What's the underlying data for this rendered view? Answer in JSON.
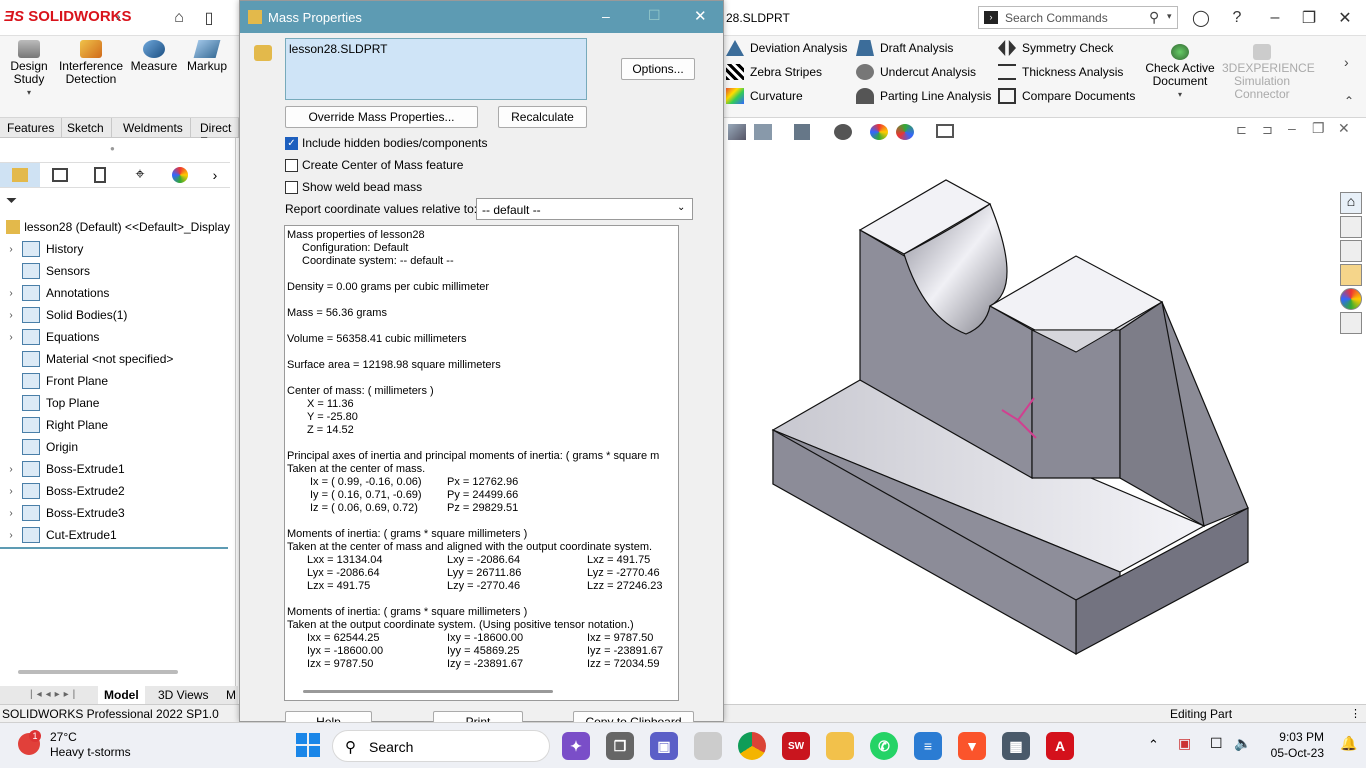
{
  "app": {
    "brand": "SOLIDWORKS",
    "doc_title": "28.SLDPRT"
  },
  "search": {
    "placeholder": "Search Commands"
  },
  "ribbon": {
    "big": [
      {
        "label": "Design Study"
      },
      {
        "label": "Interference Detection"
      },
      {
        "label": "Measure"
      },
      {
        "label": "Markup"
      }
    ],
    "col1": [
      "Deviation Analysis",
      "Zebra Stripes",
      "Curvature"
    ],
    "col2": [
      "Draft Analysis",
      "Undercut Analysis",
      "Parting Line Analysis"
    ],
    "col3": [
      "Symmetry Check",
      "Thickness Analysis",
      "Compare Documents"
    ],
    "check_active": "Check Active Document",
    "sim_connector": "3DEXPERIENCE Simulation Connector"
  },
  "tabs": [
    "Features",
    "Sketch",
    "Weldments",
    "Direct E"
  ],
  "tree": {
    "root": "lesson28 (Default) <<Default>_Display",
    "items": [
      {
        "label": "History",
        "exp": true
      },
      {
        "label": "Sensors",
        "exp": false
      },
      {
        "label": "Annotations",
        "exp": true
      },
      {
        "label": "Solid Bodies(1)",
        "exp": true
      },
      {
        "label": "Equations",
        "exp": true
      },
      {
        "label": "Material <not specified>",
        "exp": false
      },
      {
        "label": "Front Plane",
        "exp": false
      },
      {
        "label": "Top Plane",
        "exp": false
      },
      {
        "label": "Right Plane",
        "exp": false
      },
      {
        "label": "Origin",
        "exp": false
      },
      {
        "label": "Boss-Extrude1",
        "exp": true
      },
      {
        "label": "Boss-Extrude2",
        "exp": true
      },
      {
        "label": "Boss-Extrude3",
        "exp": true
      },
      {
        "label": "Cut-Extrude1",
        "exp": true
      }
    ]
  },
  "bottom_tabs": [
    "Model",
    "3D Views",
    "M"
  ],
  "dialog": {
    "title": "Mass Properties",
    "selection": "lesson28.SLDPRT",
    "options_btn": "Options...",
    "override_btn": "Override Mass Properties...",
    "recalc_btn": "Recalculate",
    "chk_hidden": "Include hidden bodies/components",
    "chk_com": "Create Center of Mass feature",
    "chk_weld": "Show weld bead mass",
    "coord_label": "Report coordinate values relative to:",
    "coord_value": "-- default --",
    "help_btn": "Help",
    "print_btn": "Print",
    "copy_btn": "Copy to Clipboard",
    "results": {
      "header": "Mass properties of lesson28",
      "config": "Configuration: Default",
      "coordsys": "Coordinate system: -- default --",
      "density": "Density = 0.00 grams per cubic millimeter",
      "mass": "Mass = 56.36 grams",
      "volume": "Volume = 56358.41 cubic millimeters",
      "area": "Surface area = 12198.98  square millimeters",
      "com_title": "Center of mass: ( millimeters )",
      "com_x": "X = 11.36",
      "com_y": "Y = -25.80",
      "com_z": "Z = 14.52",
      "pa_title": "Principal axes of inertia and principal moments of inertia: ( grams *  square m",
      "pa_sub": "Taken at the center of mass.",
      "ix": "Ix = ( 0.99, -0.16,  0.06)",
      "iy": "Iy = ( 0.16,  0.71, -0.69)",
      "iz": "Iz = ( 0.06,  0.69,  0.72)",
      "px": "Px = 12762.96",
      "py": "Py = 24499.66",
      "pz": "Pz = 29829.51",
      "m1_title": "Moments of inertia: ( grams *  square millimeters )",
      "m1_sub": "Taken at the center of mass and aligned with the output coordinate system.",
      "lxx": "Lxx = 13134.04",
      "lxy": "Lxy = -2086.64",
      "lxz": "Lxz = 491.75",
      "lyx": "Lyx = -2086.64",
      "lyy": "Lyy = 26711.86",
      "lyz": "Lyz = -2770.46",
      "lzx": "Lzx = 491.75",
      "lzy": "Lzy = -2770.46",
      "lzz": "Lzz = 27246.23",
      "m2_title": "Moments of inertia: ( grams *  square millimeters )",
      "m2_sub": "Taken at the output coordinate system. (Using positive tensor notation.)",
      "ixx": "Ixx = 62544.25",
      "ixy": "Ixy = -18600.00",
      "ixz": "Ixz = 9787.50",
      "iyx": "Iyx = -18600.00",
      "iyy": "Iyy = 45869.25",
      "iyz": "Iyz = -23891.67",
      "izx": "Izx = 9787.50",
      "izy": "Izy = -23891.67",
      "izz": "Izz = 72034.59"
    }
  },
  "status": {
    "left": "SOLIDWORKS Professional 2022 SP1.0",
    "right": "Editing Part"
  },
  "taskbar": {
    "temp": "27°C",
    "weather": "Heavy t-storms",
    "search": "Search",
    "time": "9:03 PM",
    "date": "05-Oct-23",
    "badge": "1"
  }
}
